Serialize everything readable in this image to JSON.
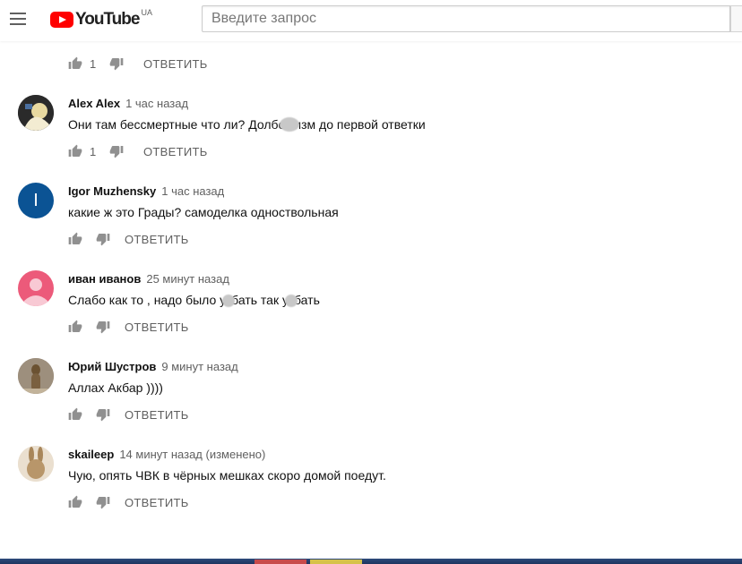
{
  "header": {
    "logo_text": "YouTube",
    "logo_country": "UA",
    "search_placeholder": "Введите запрос"
  },
  "reply_label": "ОТВЕТИТЬ",
  "top_actions": {
    "likes": "1"
  },
  "comments": [
    {
      "author": "Alex Alex",
      "time": "1 час назад",
      "text_parts": [
        "Они там бессмертные что ли? Долбо",
        "изм до первой ответки"
      ],
      "likes": "1",
      "avatar": "photo-avatar"
    },
    {
      "author": "Igor Muzhensky",
      "time": "1 час назад",
      "text_parts": [
        "какие ж это Грады? самоделка одноствольная"
      ],
      "likes": "",
      "avatar_letter": "I",
      "avatar_color": "#0b5394"
    },
    {
      "author": "иван иванов",
      "time": "25 минут назад",
      "text_parts": [
        "Слабо как то , надо было у",
        "бать так у",
        "бать"
      ],
      "likes": "",
      "avatar": "default-user-icon",
      "avatar_color": "#ec5a7a"
    },
    {
      "author": "Юрий Шустров",
      "time": "9 минут назад",
      "text_parts": [
        "Аллах Акбар ))))"
      ],
      "likes": "",
      "avatar": "meerkat-photo-avatar"
    },
    {
      "author": "skaileep",
      "time": "14 минут назад (изменено)",
      "text_parts": [
        "Чую, опять  ЧВК в чёрных мешках скоро домой поедут."
      ],
      "likes": "",
      "avatar": "rabbit-photo-avatar"
    }
  ],
  "colors": {
    "youtube_red": "#ff0000",
    "text_primary": "#111111",
    "text_secondary": "#606060",
    "icon_gray": "#909090"
  }
}
